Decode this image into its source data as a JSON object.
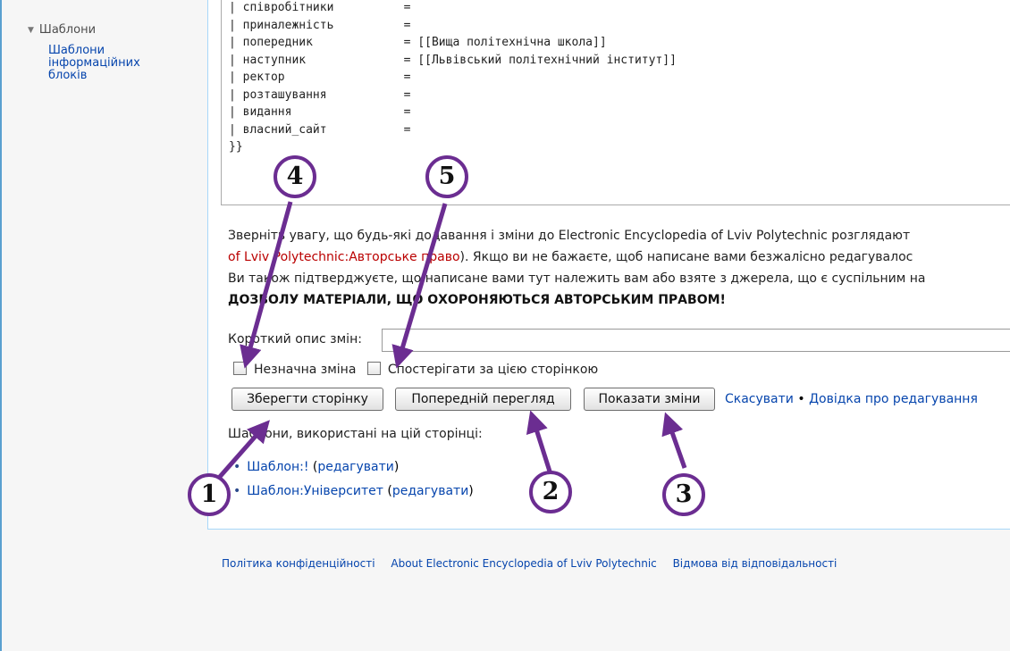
{
  "sidebar": {
    "section_title": "Шаблони",
    "link": "Шаблони інформаційних блоків"
  },
  "editor": {
    "lines": [
      "| співробітники          =",
      "| приналежність          =",
      "| попередник             = [[Вища політехнічна школа]]",
      "| наступник              = [[Львівський політехнічний інститут]]",
      "| ректор                 =",
      "| розташування           =",
      "| видання                =",
      "| власний_сайт           =",
      "}}"
    ]
  },
  "notice": {
    "line1": "Зверніть увагу, що будь-які додавання і зміни до Electronic Encyclopedia of Lviv Polytechnic розглядают",
    "line2_link": "of Lviv Polytechnic:Авторське право",
    "line2_rest": "). Якщо ви не бажаєте, щоб написане вами безжалісно редагувалос",
    "line3": "Ви також підтверджуєте, що написане вами тут належить вам або взяте з джерела, що є суспільним на",
    "line4_bold": "ДОЗВОЛУ МАТЕРІАЛИ, ЩО ОХОРОНЯЮТЬСЯ АВТОРСЬКИМ ПРАВОМ!"
  },
  "form": {
    "summary_label": "Короткий опис змін:",
    "summary_value": "",
    "minor_label": "Незначна зміна",
    "watch_label": "Спостерігати за цією сторінкою",
    "save_button": "Зберегти сторінку",
    "preview_button": "Попередній перегляд",
    "diff_button": "Показати зміни",
    "cancel_link": "Скасувати",
    "separator": "•",
    "help_link": "Довідка про редагування"
  },
  "templates": {
    "heading": "Шаблони, використані на цій сторінці:",
    "items": [
      {
        "name": "Шаблон:!",
        "edit": "редагувати"
      },
      {
        "name": "Шаблон:Університет",
        "edit": "редагувати"
      }
    ]
  },
  "footer": {
    "privacy": "Політика конфіденційності",
    "about": "About Electronic Encyclopedia of Lviv Polytechnic",
    "disclaimer": "Відмова від відповідальності"
  },
  "annotations": {
    "markers": [
      "1",
      "2",
      "3",
      "4",
      "5"
    ],
    "color": "#6b2d91"
  }
}
